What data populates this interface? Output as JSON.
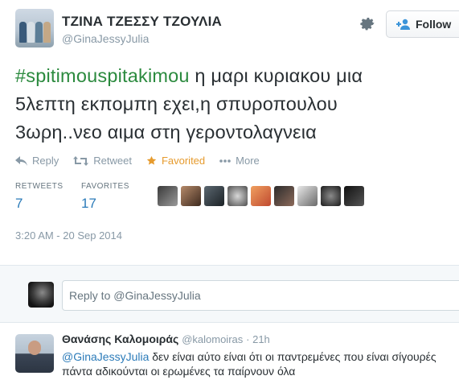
{
  "tweet": {
    "author_name": "ΤΖΙΝΑ ΤΖΕΣΣΥ ΤΖΟΥΛΙΑ",
    "author_handle": "@GinaJessyJulia",
    "follow_label": "Follow",
    "hashtag": "#spitimouspitakimou",
    "text_line1": " η μαρι κυριακου μια",
    "text_line2": "5λεπτη εκπομπη εχει,η σπυροπουλου",
    "text_line3": "3ωρη..νεο αιμα στη γεροντολαγνεια",
    "actions": {
      "reply": "Reply",
      "retweet": "Retweet",
      "favorited": "Favorited",
      "more": "More"
    },
    "stats": {
      "retweets_label": "RETWEETS",
      "retweets_value": "7",
      "favorites_label": "FAVORITES",
      "favorites_value": "17"
    },
    "timestamp": "3:20 AM - 20 Sep 2014"
  },
  "reply_box": {
    "placeholder": "Reply to @GinaJessyJulia"
  },
  "reply": {
    "author_name": "Θανάσης Καλομοιράς",
    "author_handle": "@kalomoiras",
    "time": "· 21h",
    "mention": "@GinaJessyJulia",
    "text_line1": " δεν είναι αύτο είναι ότι οι παντρεμένες που είναι σίγουρές",
    "text_line2": "πάντα αδικούνται οι ερωμένες τα παίρνουν όλα"
  },
  "colors": {
    "link": "#2b7bb9",
    "hashtag": "#2b8a3e",
    "favorited": "#e69b2e",
    "muted": "#8899a6"
  },
  "icons": [
    "gear-icon",
    "follow-person-icon",
    "reply-icon",
    "retweet-icon",
    "star-icon",
    "more-dots-icon"
  ]
}
